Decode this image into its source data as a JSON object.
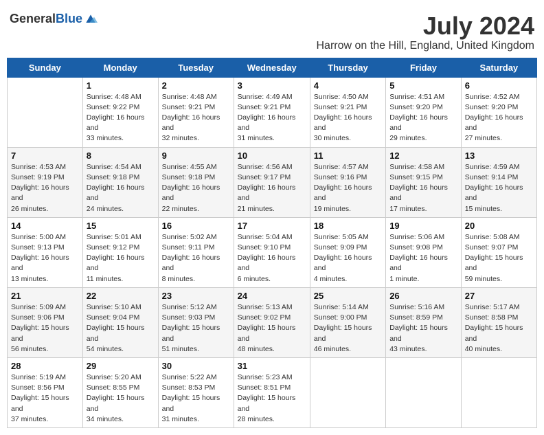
{
  "header": {
    "logo_general": "General",
    "logo_blue": "Blue",
    "month_title": "July 2024",
    "location": "Harrow on the Hill, England, United Kingdom"
  },
  "weekdays": [
    "Sunday",
    "Monday",
    "Tuesday",
    "Wednesday",
    "Thursday",
    "Friday",
    "Saturday"
  ],
  "weeks": [
    [
      {
        "day": "",
        "sunrise": "",
        "sunset": "",
        "daylight": ""
      },
      {
        "day": "1",
        "sunrise": "4:48 AM",
        "sunset": "9:22 PM",
        "daylight": "16 hours and 33 minutes."
      },
      {
        "day": "2",
        "sunrise": "4:48 AM",
        "sunset": "9:21 PM",
        "daylight": "16 hours and 32 minutes."
      },
      {
        "day": "3",
        "sunrise": "4:49 AM",
        "sunset": "9:21 PM",
        "daylight": "16 hours and 31 minutes."
      },
      {
        "day": "4",
        "sunrise": "4:50 AM",
        "sunset": "9:21 PM",
        "daylight": "16 hours and 30 minutes."
      },
      {
        "day": "5",
        "sunrise": "4:51 AM",
        "sunset": "9:20 PM",
        "daylight": "16 hours and 29 minutes."
      },
      {
        "day": "6",
        "sunrise": "4:52 AM",
        "sunset": "9:20 PM",
        "daylight": "16 hours and 27 minutes."
      }
    ],
    [
      {
        "day": "7",
        "sunrise": "4:53 AM",
        "sunset": "9:19 PM",
        "daylight": "16 hours and 26 minutes."
      },
      {
        "day": "8",
        "sunrise": "4:54 AM",
        "sunset": "9:18 PM",
        "daylight": "16 hours and 24 minutes."
      },
      {
        "day": "9",
        "sunrise": "4:55 AM",
        "sunset": "9:18 PM",
        "daylight": "16 hours and 22 minutes."
      },
      {
        "day": "10",
        "sunrise": "4:56 AM",
        "sunset": "9:17 PM",
        "daylight": "16 hours and 21 minutes."
      },
      {
        "day": "11",
        "sunrise": "4:57 AM",
        "sunset": "9:16 PM",
        "daylight": "16 hours and 19 minutes."
      },
      {
        "day": "12",
        "sunrise": "4:58 AM",
        "sunset": "9:15 PM",
        "daylight": "16 hours and 17 minutes."
      },
      {
        "day": "13",
        "sunrise": "4:59 AM",
        "sunset": "9:14 PM",
        "daylight": "16 hours and 15 minutes."
      }
    ],
    [
      {
        "day": "14",
        "sunrise": "5:00 AM",
        "sunset": "9:13 PM",
        "daylight": "16 hours and 13 minutes."
      },
      {
        "day": "15",
        "sunrise": "5:01 AM",
        "sunset": "9:12 PM",
        "daylight": "16 hours and 11 minutes."
      },
      {
        "day": "16",
        "sunrise": "5:02 AM",
        "sunset": "9:11 PM",
        "daylight": "16 hours and 8 minutes."
      },
      {
        "day": "17",
        "sunrise": "5:04 AM",
        "sunset": "9:10 PM",
        "daylight": "16 hours and 6 minutes."
      },
      {
        "day": "18",
        "sunrise": "5:05 AM",
        "sunset": "9:09 PM",
        "daylight": "16 hours and 4 minutes."
      },
      {
        "day": "19",
        "sunrise": "5:06 AM",
        "sunset": "9:08 PM",
        "daylight": "16 hours and 1 minute."
      },
      {
        "day": "20",
        "sunrise": "5:08 AM",
        "sunset": "9:07 PM",
        "daylight": "15 hours and 59 minutes."
      }
    ],
    [
      {
        "day": "21",
        "sunrise": "5:09 AM",
        "sunset": "9:06 PM",
        "daylight": "15 hours and 56 minutes."
      },
      {
        "day": "22",
        "sunrise": "5:10 AM",
        "sunset": "9:04 PM",
        "daylight": "15 hours and 54 minutes."
      },
      {
        "day": "23",
        "sunrise": "5:12 AM",
        "sunset": "9:03 PM",
        "daylight": "15 hours and 51 minutes."
      },
      {
        "day": "24",
        "sunrise": "5:13 AM",
        "sunset": "9:02 PM",
        "daylight": "15 hours and 48 minutes."
      },
      {
        "day": "25",
        "sunrise": "5:14 AM",
        "sunset": "9:00 PM",
        "daylight": "15 hours and 46 minutes."
      },
      {
        "day": "26",
        "sunrise": "5:16 AM",
        "sunset": "8:59 PM",
        "daylight": "15 hours and 43 minutes."
      },
      {
        "day": "27",
        "sunrise": "5:17 AM",
        "sunset": "8:58 PM",
        "daylight": "15 hours and 40 minutes."
      }
    ],
    [
      {
        "day": "28",
        "sunrise": "5:19 AM",
        "sunset": "8:56 PM",
        "daylight": "15 hours and 37 minutes."
      },
      {
        "day": "29",
        "sunrise": "5:20 AM",
        "sunset": "8:55 PM",
        "daylight": "15 hours and 34 minutes."
      },
      {
        "day": "30",
        "sunrise": "5:22 AM",
        "sunset": "8:53 PM",
        "daylight": "15 hours and 31 minutes."
      },
      {
        "day": "31",
        "sunrise": "5:23 AM",
        "sunset": "8:51 PM",
        "daylight": "15 hours and 28 minutes."
      },
      {
        "day": "",
        "sunrise": "",
        "sunset": "",
        "daylight": ""
      },
      {
        "day": "",
        "sunrise": "",
        "sunset": "",
        "daylight": ""
      },
      {
        "day": "",
        "sunrise": "",
        "sunset": "",
        "daylight": ""
      }
    ]
  ]
}
